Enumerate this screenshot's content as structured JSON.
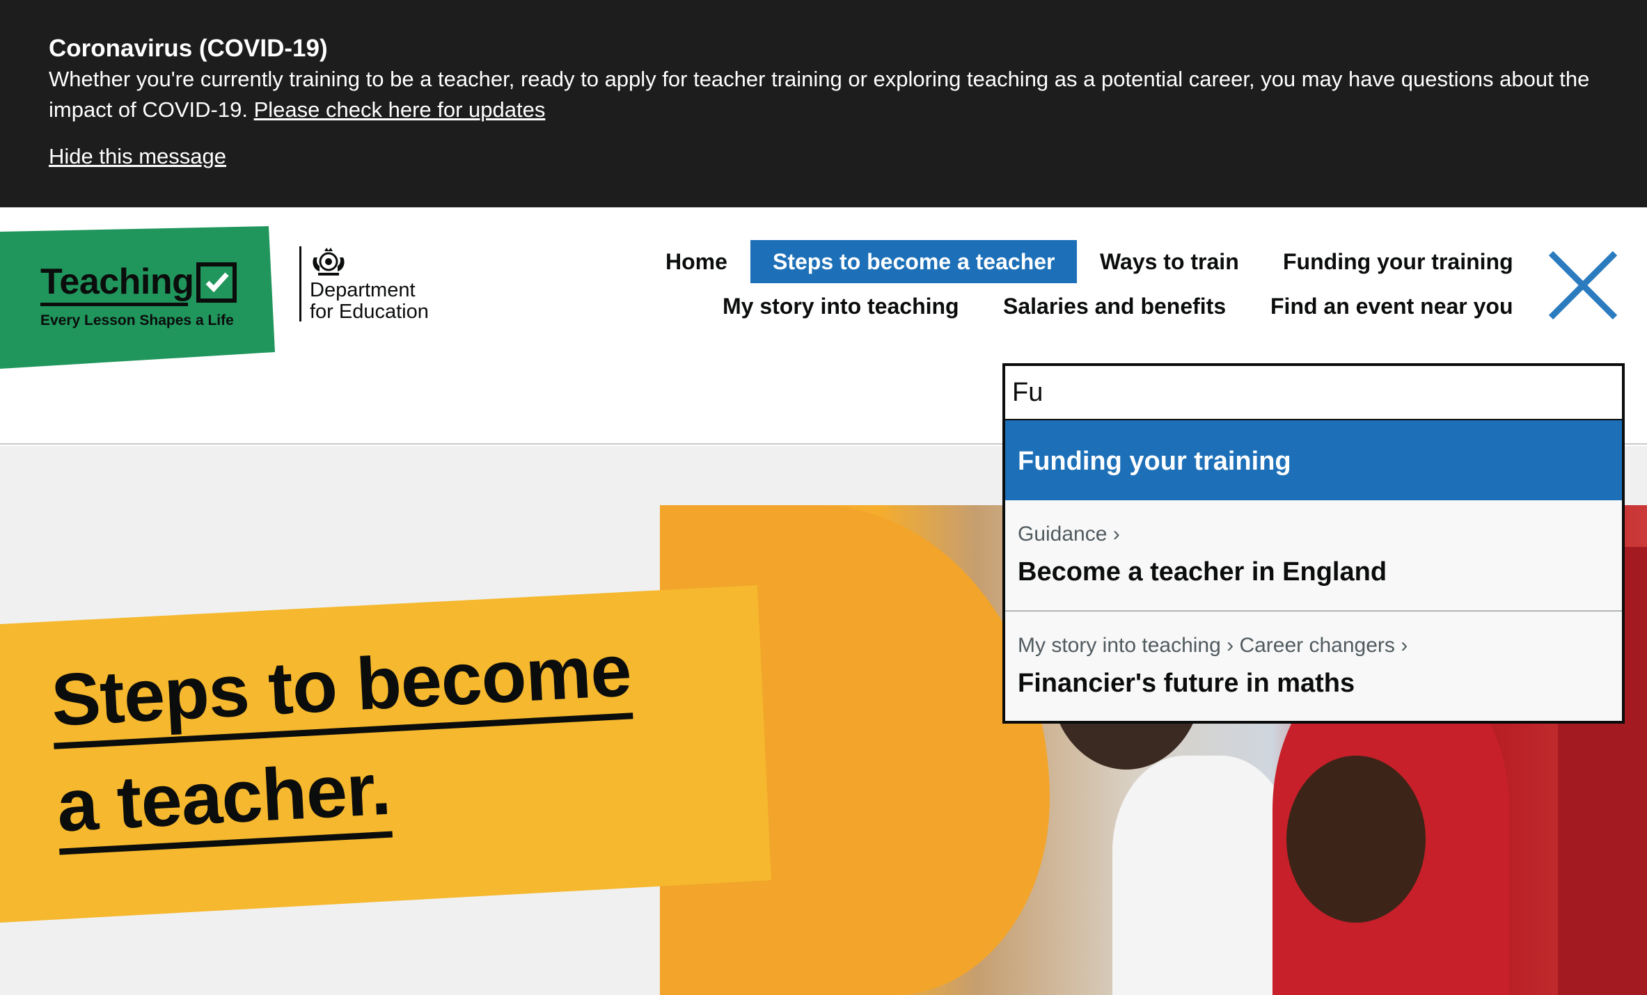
{
  "banner": {
    "title": "Coronavirus (COVID-19)",
    "text": "Whether you're currently training to be a teacher, ready to apply for teacher training or exploring teaching as a potential career, you may have questions about the impact of COVID-19. ",
    "link": "Please check here for updates",
    "hide": "Hide this message"
  },
  "logo": {
    "word": "Teaching",
    "tagline": "Every Lesson Shapes a Life",
    "brand_color": "#20965c"
  },
  "dfe": {
    "line1": "Department",
    "line2": "for Education"
  },
  "nav": {
    "home": "Home",
    "steps": "Steps to become a teacher",
    "ways": "Ways to train",
    "funding": "Funding your training",
    "story": "My story into teaching",
    "salaries": "Salaries and benefits",
    "events": "Find an event near you",
    "active_color": "#1d70b8"
  },
  "search": {
    "value": "Fu",
    "results": [
      {
        "title": "Funding your training",
        "breadcrumb": ""
      },
      {
        "breadcrumb": "Guidance ›",
        "title": "Become a teacher in England"
      },
      {
        "breadcrumb": "My story into teaching › Career changers ›",
        "title": "Financier's future in maths"
      }
    ]
  },
  "hero": {
    "line1": "Steps to become",
    "line2": "a teacher.",
    "panel_color": "#f5b82e"
  }
}
